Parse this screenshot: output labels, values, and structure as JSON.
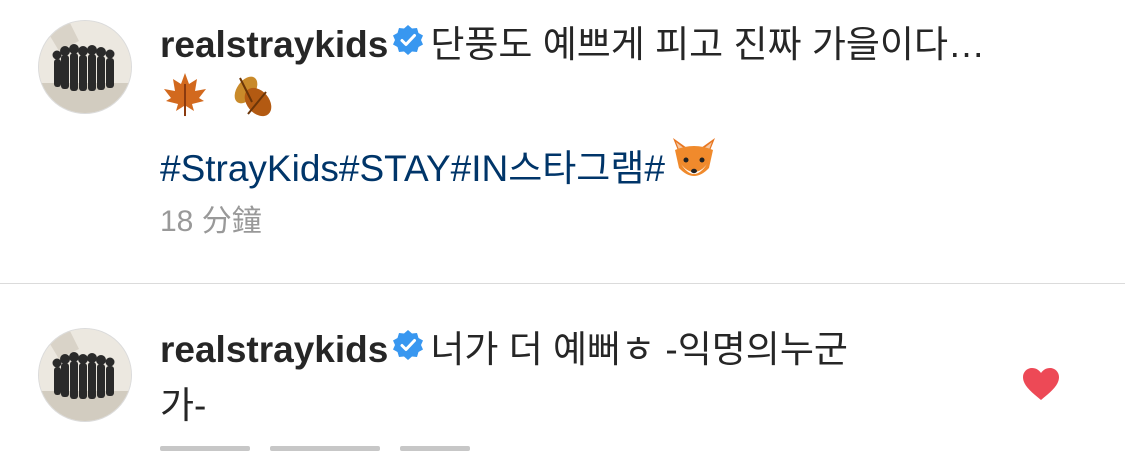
{
  "comments": [
    {
      "username": "realstraykids",
      "text": "단풍도 예쁘게 피고 진짜 가을이다…",
      "hashtags": "#StrayKids#STAY#IN스타그램#",
      "timestamp": "18 分鐘",
      "emojis": [
        "maple-leaf",
        "fallen-leaf",
        "fox-face"
      ]
    },
    {
      "username": "realstraykids",
      "text": "너가 더 예뻐ㅎ -익명의누군",
      "text_cont": "가-",
      "liked": true
    }
  ],
  "colors": {
    "hashtag": "#003569",
    "verified": "#3897f0",
    "heart": "#ed4956",
    "timestamp": "#999999",
    "divider": "#dbdbdb"
  }
}
